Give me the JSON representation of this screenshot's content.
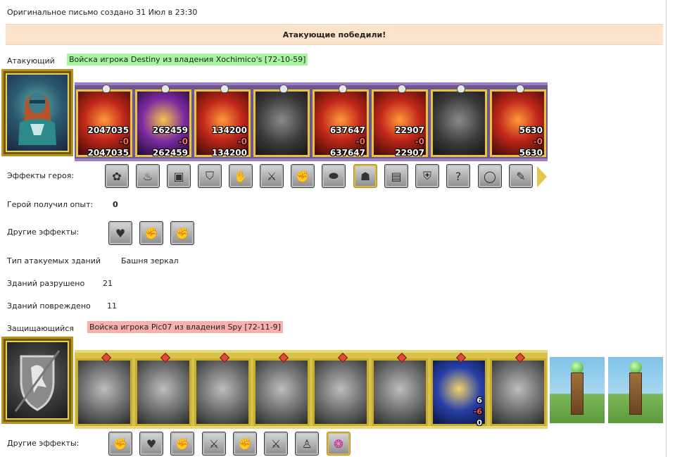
{
  "header": {
    "created": "Оригинальное письмо создано 31 Июл в 23:30",
    "result": "Атакующие победили!"
  },
  "attacker": {
    "label": "Атакующий",
    "name": "Войска игрока Destiny из владения Xochimico's [72-10-59]",
    "troops": [
      {
        "start": "2047035",
        "loss": "-0",
        "end": "2047035"
      },
      {
        "start": "262459",
        "loss": "-0",
        "end": "262459"
      },
      {
        "start": "134200",
        "loss": "-0",
        "end": "134200"
      },
      {
        "start": "",
        "loss": "",
        "end": ""
      },
      {
        "start": "637647",
        "loss": "-0",
        "end": "637647"
      },
      {
        "start": "22907",
        "loss": "-0",
        "end": "22907"
      },
      {
        "start": "",
        "loss": "",
        "end": ""
      },
      {
        "start": "5630",
        "loss": "-0",
        "end": "5630"
      }
    ],
    "hero_effects_label": "Эффекты героя:",
    "hero_effects_icons": [
      "scroll-icon",
      "cauldron-icon",
      "box-icon",
      "shield-icon",
      "hand-shield-icon",
      "sword-icon",
      "hand-sword-icon",
      "boot-icon",
      "helmet-icon",
      "armor-icon",
      "chestplate-icon",
      "question-icon",
      "ring-icon",
      "parchment-icon"
    ],
    "exp_label": "Герой получил опыт:",
    "exp_value": "0",
    "other_effects_label": "Другие эффекты:",
    "other_effects_icons": [
      "heart-sword-icon",
      "hand-sword-icon",
      "hand-sword-icon"
    ],
    "building_type_label": "Тип атакуемых зданий",
    "building_type_value": "Башня зеркал",
    "destroyed_label": "Зданий разрушено",
    "destroyed_value": "21",
    "damaged_label": "Зданий повреждено",
    "damaged_value": "11"
  },
  "defender": {
    "label": "Защищающийся",
    "name": "Войска игрока Pic07 из владения Spy [72-11-9]",
    "troop_counts": {
      "start": "6",
      "loss": "-6",
      "end": "0"
    },
    "other_effects_label": "Другие эффекты:",
    "other_effects_icons": [
      "hand-sword-icon",
      "heart-sword-icon",
      "hand-sword-icon",
      "sword-icon",
      "hand-sword-icon",
      "sword-icon",
      "pawn-icon",
      "gem-icon"
    ]
  }
}
